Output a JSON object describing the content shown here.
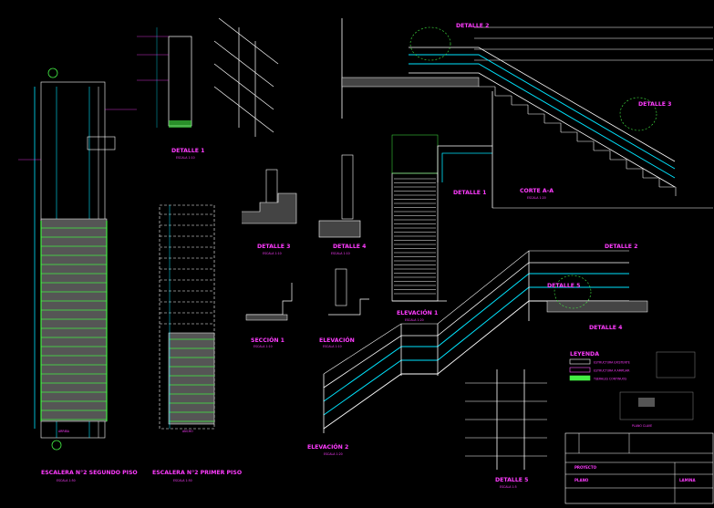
{
  "drawing": {
    "views": {
      "detalle1": {
        "title": "DETALLE 1",
        "scale": "ESCALA 1:10"
      },
      "detalle3": {
        "title": "DETALLE 3",
        "scale": "ESCALA 1:10"
      },
      "detalle4": {
        "title": "DETALLE 4",
        "scale": "ESCALA 1:10"
      },
      "seccion1": {
        "title": "SECCIÓN 1",
        "scale": "ESCALA 1:10"
      },
      "elevacion1_small": {
        "title": "ELEVACIÓN",
        "scale": "ESCALA 1:10"
      },
      "elevacion1": {
        "title": "ELEVACIÓN 1",
        "scale": "ESCALA 1:20"
      },
      "elevacion2": {
        "title": "ELEVACIÓN 2",
        "scale": "ESCALA 1:20"
      },
      "corte_aa": {
        "title": "CORTE A-A",
        "scale": "ESCALA 1:20"
      },
      "detalle5": {
        "title": "DETALLE 5",
        "scale": "ESCALA 1:5"
      },
      "escalera2": {
        "title": "ESCALERA N°2 SEGUNDO PISO",
        "scale": "ESCALA 1:50"
      },
      "escalera1": {
        "title": "ESCALERA N°2 PRIMER PISO",
        "scale": "ESCALA 1:50"
      }
    },
    "callouts": {
      "c1": "DETALLE 2",
      "c2": "DETALLE 3",
      "c3": "DETALLE 1",
      "c4": "DETALLE 2",
      "c5": "DETALLE 4",
      "c6": "DETALLE 5"
    },
    "legend": {
      "title": "LEYENDA",
      "items": [
        {
          "label": "ESTRUCTURA EXISTENTE",
          "color": "#ffffff"
        },
        {
          "label": "ESTRUCTURA A AMPLIAR",
          "color": "#ff55ff"
        },
        {
          "label": "TIJERALES CONTINUOS",
          "color": "#44ee44"
        }
      ]
    },
    "key_plan": {
      "label": "PLANO CLAVE"
    },
    "plan_marks": {
      "arriba": "ARRIBA",
      "ancho": "ANCHO"
    },
    "title_block": {
      "project_label": "PROYECTO",
      "sheet_label": "PLANO",
      "lamina_label": "LAMINA"
    },
    "colors": {
      "background": "#000000",
      "magenta": "#ff3cff",
      "cyan": "#00e5ff",
      "white": "#ffffff",
      "green": "#44ee44",
      "gray": "#666666"
    }
  }
}
